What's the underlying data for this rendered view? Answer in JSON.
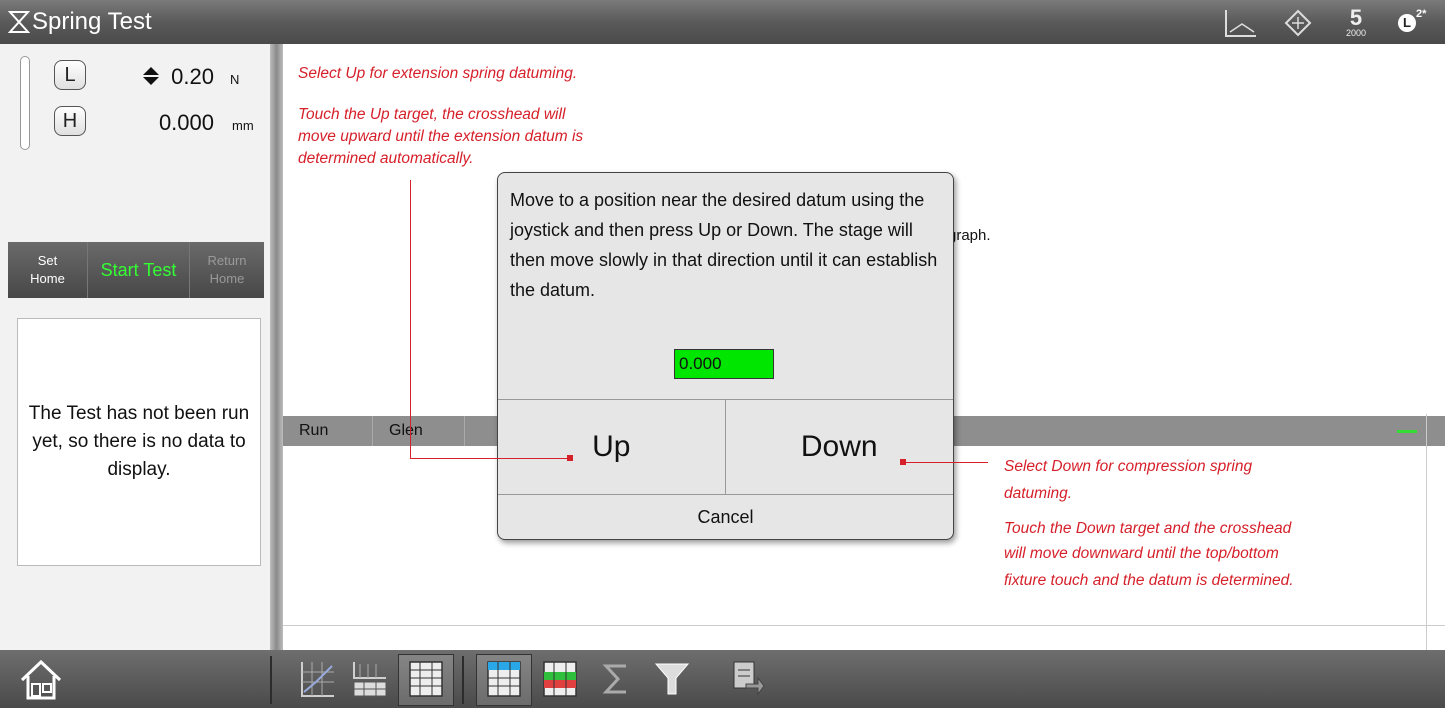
{
  "window": {
    "title": "Spring Test"
  },
  "title_icons": [
    "axes-icon",
    "target-icon",
    "s2000-icon",
    "l2-badge-icon"
  ],
  "title_icon_labels": {
    "s_model": "2000",
    "badge_letter": "L",
    "badge_sup": "2*"
  },
  "readouts": {
    "load": {
      "button": "L",
      "value": "0.20",
      "unit": "N"
    },
    "height": {
      "button": "H",
      "value": "0.000",
      "unit": "mm"
    }
  },
  "left_buttons": [
    {
      "label_line1": "Set",
      "label_line2": "Home",
      "enabled": true
    },
    {
      "label": "Start Test",
      "enabled": true
    },
    {
      "label_line1": "Return",
      "label_line2": "Home",
      "enabled": false
    }
  ],
  "no_data_message": "The Test has not been run yet, so there is no data to display.",
  "partial_background_text": "graph.",
  "grid_columns": [
    "Run",
    "Glen"
  ],
  "dialog": {
    "message": "Move to a position near the desired datum using the joystick and then press Up or Down. The stage will then move slowly in that direction until it can establish the datum.",
    "value": "0.000",
    "up_label": "Up",
    "down_label": "Down",
    "cancel_label": "Cancel"
  },
  "annotations": {
    "up_title": "Select Up for extension spring datuming.",
    "up_detail_line1": "Touch the Up target, the crosshead will",
    "up_detail_line2": "move upward until the extension datum is",
    "up_detail_line3": "determined automatically.",
    "down_title_line1": "Select Down for compression spring",
    "down_title_line2": "datuming.",
    "down_detail_line1": "Touch the Down target and the crosshead",
    "down_detail_line2": "will move downward until the top/bottom",
    "down_detail_line3": "fixture touch and the datum is determined."
  },
  "bottom_icons": [
    "home-icon",
    "graph-icon",
    "graph-table-icon",
    "table-icon",
    "results-table-icon",
    "color-table-icon",
    "sigma-icon",
    "filter-icon",
    "export-icon"
  ],
  "colors": {
    "annotation_red": "#d6202a",
    "start_green": "#33ff33",
    "field_green": "#00e600"
  }
}
